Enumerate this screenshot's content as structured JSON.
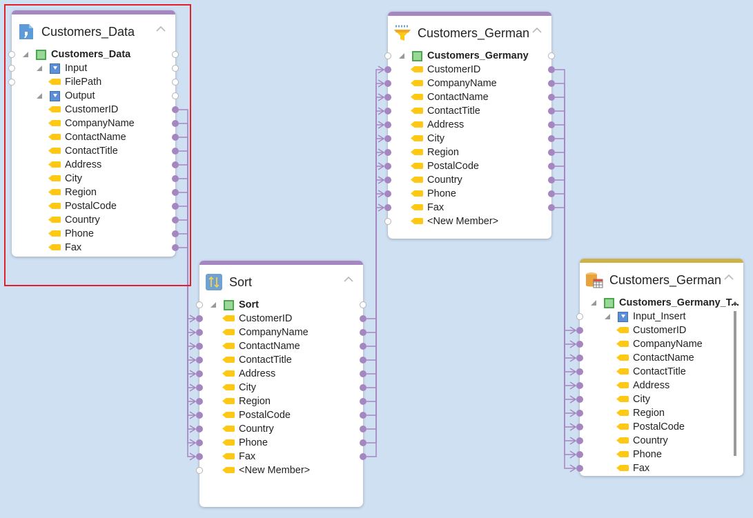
{
  "colors": {
    "background": "#cfe0f2",
    "wire": "#a686c0",
    "selection": "#e0202a",
    "bar_purple": "#a686c0",
    "bar_gold": "#cdb24a"
  },
  "nodes": [
    {
      "id": "customers-data",
      "title": "Customers_Data",
      "icon": "text-file-icon",
      "bar": "purple",
      "selected": true,
      "rows": [
        {
          "label": "Customers_Data",
          "kind": "entity",
          "depth": 0,
          "bold": true,
          "left": "open",
          "right": "open"
        },
        {
          "label": "Input",
          "kind": "group",
          "depth": 1,
          "left": "open",
          "right": "open"
        },
        {
          "label": "FilePath",
          "kind": "field",
          "depth": 2,
          "left": "open",
          "right": "open"
        },
        {
          "label": "Output",
          "kind": "group",
          "depth": 1,
          "left": "none",
          "right": "open"
        },
        {
          "label": "CustomerID",
          "kind": "field",
          "depth": 2,
          "left": "none",
          "right": "filled"
        },
        {
          "label": "CompanyName",
          "kind": "field",
          "depth": 2,
          "left": "none",
          "right": "filled"
        },
        {
          "label": "ContactName",
          "kind": "field",
          "depth": 2,
          "left": "none",
          "right": "filled"
        },
        {
          "label": "ContactTitle",
          "kind": "field",
          "depth": 2,
          "left": "none",
          "right": "filled"
        },
        {
          "label": "Address",
          "kind": "field",
          "depth": 2,
          "left": "none",
          "right": "filled"
        },
        {
          "label": "City",
          "kind": "field",
          "depth": 2,
          "left": "none",
          "right": "filled"
        },
        {
          "label": "Region",
          "kind": "field",
          "depth": 2,
          "left": "none",
          "right": "filled"
        },
        {
          "label": "PostalCode",
          "kind": "field",
          "depth": 2,
          "left": "none",
          "right": "filled"
        },
        {
          "label": "Country",
          "kind": "field",
          "depth": 2,
          "left": "none",
          "right": "filled"
        },
        {
          "label": "Phone",
          "kind": "field",
          "depth": 2,
          "left": "none",
          "right": "filled"
        },
        {
          "label": "Fax",
          "kind": "field",
          "depth": 2,
          "left": "none",
          "right": "filled"
        }
      ]
    },
    {
      "id": "sort",
      "title": "Sort",
      "icon": "sort-icon",
      "bar": "purple",
      "rows": [
        {
          "label": "Sort",
          "kind": "entity",
          "depth": 0,
          "bold": true,
          "left": "open",
          "right": "open"
        },
        {
          "label": "CustomerID",
          "kind": "field",
          "depth": 1,
          "left": "filled",
          "right": "filled"
        },
        {
          "label": "CompanyName",
          "kind": "field",
          "depth": 1,
          "left": "filled",
          "right": "filled"
        },
        {
          "label": "ContactName",
          "kind": "field",
          "depth": 1,
          "left": "filled",
          "right": "filled"
        },
        {
          "label": "ContactTitle",
          "kind": "field",
          "depth": 1,
          "left": "filled",
          "right": "filled"
        },
        {
          "label": "Address",
          "kind": "field",
          "depth": 1,
          "left": "filled",
          "right": "filled"
        },
        {
          "label": "City",
          "kind": "field",
          "depth": 1,
          "left": "filled",
          "right": "filled"
        },
        {
          "label": "Region",
          "kind": "field",
          "depth": 1,
          "left": "filled",
          "right": "filled"
        },
        {
          "label": "PostalCode",
          "kind": "field",
          "depth": 1,
          "left": "filled",
          "right": "filled"
        },
        {
          "label": "Country",
          "kind": "field",
          "depth": 1,
          "left": "filled",
          "right": "filled"
        },
        {
          "label": "Phone",
          "kind": "field",
          "depth": 1,
          "left": "filled",
          "right": "filled"
        },
        {
          "label": "Fax",
          "kind": "field",
          "depth": 1,
          "left": "filled",
          "right": "filled"
        },
        {
          "label": "<New Member>",
          "kind": "field",
          "depth": 1,
          "left": "open",
          "right": "none"
        }
      ]
    },
    {
      "id": "filter",
      "title": "Customers_Germany",
      "icon": "filter-icon",
      "bar": "purple",
      "rows": [
        {
          "label": "Customers_Germany",
          "kind": "entity",
          "depth": 0,
          "bold": true,
          "left": "open",
          "right": "open"
        },
        {
          "label": "CustomerID",
          "kind": "field",
          "depth": 1,
          "left": "filled",
          "right": "filled"
        },
        {
          "label": "CompanyName",
          "kind": "field",
          "depth": 1,
          "left": "filled",
          "right": "filled"
        },
        {
          "label": "ContactName",
          "kind": "field",
          "depth": 1,
          "left": "filled",
          "right": "filled"
        },
        {
          "label": "ContactTitle",
          "kind": "field",
          "depth": 1,
          "left": "filled",
          "right": "filled"
        },
        {
          "label": "Address",
          "kind": "field",
          "depth": 1,
          "left": "filled",
          "right": "filled"
        },
        {
          "label": "City",
          "kind": "field",
          "depth": 1,
          "left": "filled",
          "right": "filled"
        },
        {
          "label": "Region",
          "kind": "field",
          "depth": 1,
          "left": "filled",
          "right": "filled"
        },
        {
          "label": "PostalCode",
          "kind": "field",
          "depth": 1,
          "left": "filled",
          "right": "filled"
        },
        {
          "label": "Country",
          "kind": "field",
          "depth": 1,
          "left": "filled",
          "right": "filled"
        },
        {
          "label": "Phone",
          "kind": "field",
          "depth": 1,
          "left": "filled",
          "right": "filled"
        },
        {
          "label": "Fax",
          "kind": "field",
          "depth": 1,
          "left": "filled",
          "right": "filled"
        },
        {
          "label": "<New Member>",
          "kind": "field",
          "depth": 1,
          "left": "open",
          "right": "none"
        }
      ]
    },
    {
      "id": "table",
      "title": "Customers_Germany",
      "icon": "database-table-icon",
      "bar": "gold",
      "rows": [
        {
          "label": "Customers_Germany_T...",
          "kind": "entity",
          "depth": 0,
          "bold": true,
          "left": "none",
          "right": "none"
        },
        {
          "label": "Input_Insert",
          "kind": "group",
          "depth": 1,
          "left": "open",
          "right": "none"
        },
        {
          "label": "CustomerID",
          "kind": "field",
          "depth": 2,
          "left": "filled",
          "right": "none"
        },
        {
          "label": "CompanyName",
          "kind": "field",
          "depth": 2,
          "left": "filled",
          "right": "none"
        },
        {
          "label": "ContactName",
          "kind": "field",
          "depth": 2,
          "left": "filled",
          "right": "none"
        },
        {
          "label": "ContactTitle",
          "kind": "field",
          "depth": 2,
          "left": "filled",
          "right": "none"
        },
        {
          "label": "Address",
          "kind": "field",
          "depth": 2,
          "left": "filled",
          "right": "none"
        },
        {
          "label": "City",
          "kind": "field",
          "depth": 2,
          "left": "filled",
          "right": "none"
        },
        {
          "label": "Region",
          "kind": "field",
          "depth": 2,
          "left": "filled",
          "right": "none"
        },
        {
          "label": "PostalCode",
          "kind": "field",
          "depth": 2,
          "left": "filled",
          "right": "none"
        },
        {
          "label": "Country",
          "kind": "field",
          "depth": 2,
          "left": "filled",
          "right": "none"
        },
        {
          "label": "Phone",
          "kind": "field",
          "depth": 2,
          "left": "filled",
          "right": "none"
        },
        {
          "label": "Fax",
          "kind": "field",
          "depth": 2,
          "left": "filled",
          "right": "none"
        }
      ]
    }
  ],
  "connections": [
    {
      "from": "customers-data",
      "to": "sort",
      "fields": [
        "CustomerID",
        "CompanyName",
        "ContactName",
        "ContactTitle",
        "Address",
        "City",
        "Region",
        "PostalCode",
        "Country",
        "Phone",
        "Fax"
      ]
    },
    {
      "from": "sort",
      "to": "filter",
      "fields": [
        "CustomerID",
        "CompanyName",
        "ContactName",
        "ContactTitle",
        "Address",
        "City",
        "Region",
        "PostalCode",
        "Country",
        "Phone",
        "Fax"
      ]
    },
    {
      "from": "filter",
      "to": "table",
      "fields": [
        "CustomerID",
        "CompanyName",
        "ContactName",
        "ContactTitle",
        "Address",
        "City",
        "Region",
        "PostalCode",
        "Country",
        "Phone",
        "Fax"
      ]
    }
  ]
}
